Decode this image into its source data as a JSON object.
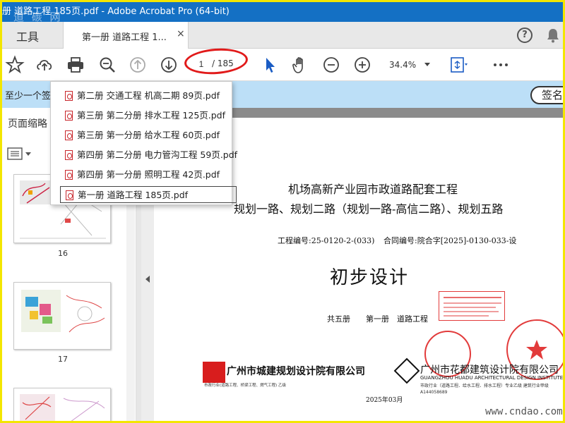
{
  "window": {
    "title": "册 道路工程 185页.pdf - Adobe Acrobat Pro (64-bit)",
    "watermark": "道 碳 网"
  },
  "tabs": {
    "tools": "工具",
    "document": "第一册 道路工程 1...",
    "close": "×",
    "help": "?"
  },
  "toolbar": {
    "page_current": "1",
    "page_total": "/ 185",
    "zoom": "34.4%"
  },
  "banner": {
    "text": "至少一个签",
    "sign_button": "签名"
  },
  "sidebar": {
    "title": "页面缩略",
    "thumbnails": [
      {
        "page": "16"
      },
      {
        "page": "17"
      },
      {
        "page": ""
      }
    ]
  },
  "dropdown": {
    "items": [
      {
        "label": "第二册 交通工程 机高二期 89页.pdf",
        "selected": false
      },
      {
        "label": "第三册 第二分册 排水工程 125页.pdf",
        "selected": false
      },
      {
        "label": "第三册 第一分册 给水工程 60页.pdf",
        "selected": false
      },
      {
        "label": "第四册 第二分册 电力管沟工程 59页.pdf",
        "selected": false
      },
      {
        "label": "第四册 第一分册 照明工程 42页.pdf",
        "selected": false
      },
      {
        "label": "第一册 道路工程 185页.pdf",
        "selected": true
      }
    ]
  },
  "document": {
    "title_line1": "机场高新产业园市政道路配套工程",
    "title_line2": "规划一路、规划二路（规划一路-高信二路）、规划五路",
    "project_no": "工程编号:25-0120-2-(033)",
    "contract_no": "合同编号:院合字[2025]-0130-033-设",
    "big_title": "初步设计",
    "volume_info": "共五册　　第一册　道路工程",
    "date": "2025年03月",
    "company1": "广州市城建规划设计院有限公司",
    "company1_sub": "市政行业(道路工程、桥梁工程、燃气工程) 乙级",
    "company2": "广州市花都建筑设计院有限公司",
    "company2_en": "GUANGZHOU HUADU ARCHITECTURAL DESIGN INSTITUTE CO.,LTD",
    "company2_sub": "市政行业（道路工程、给水工程、排水工程）专业乙级 建筑行业甲级 A144058689",
    "watermark": "www.cndao.com"
  },
  "colors": {
    "titlebar": "#1470c4",
    "banner": "#bcdff7",
    "accent_red": "#e11a1a",
    "stamp_red": "#e23b3b",
    "frame_yellow": "#f3e600"
  },
  "icons": [
    "star-icon",
    "upload-icon",
    "print-icon",
    "zoom-search-icon",
    "page-up-icon",
    "page-down-icon",
    "select-cursor-icon",
    "hand-icon",
    "zoom-out-icon",
    "zoom-in-icon",
    "fit-page-icon",
    "more-icon",
    "help-icon",
    "bell-icon",
    "pdf-file-icon"
  ]
}
